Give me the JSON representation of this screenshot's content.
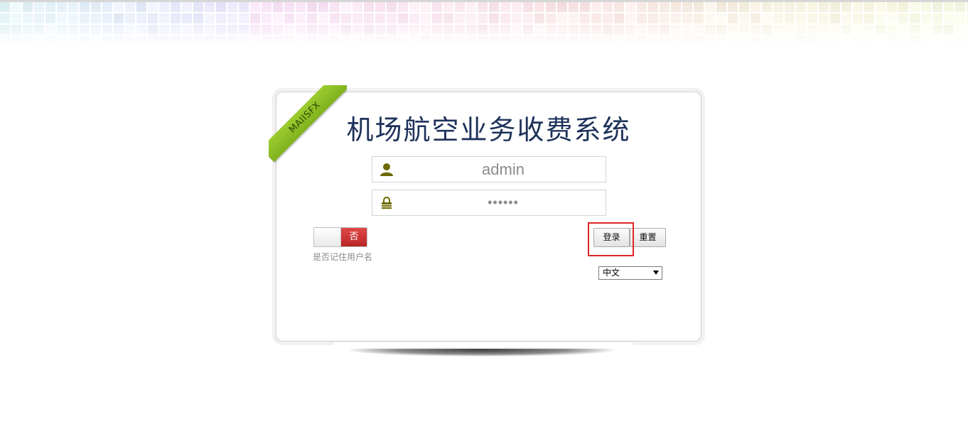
{
  "brand": {
    "ribbon_text": "MAIISFX",
    "ribbon_color": "#8dc026"
  },
  "title": "机场航空业务收费系统",
  "title_color": "#1d3159",
  "login_form": {
    "username_value": "admin",
    "password_value": "••••••",
    "username_icon": "user-icon",
    "password_icon": "lock-icon",
    "remember_toggle_state": "否",
    "remember_label": "是否记住用户名",
    "login_button": "登录",
    "reset_button": "重置",
    "language_selected": "中文"
  },
  "colors": {
    "icon_olive": "#6b6b00",
    "toggle_red": "#c93030",
    "highlight_red": "#e02424"
  }
}
